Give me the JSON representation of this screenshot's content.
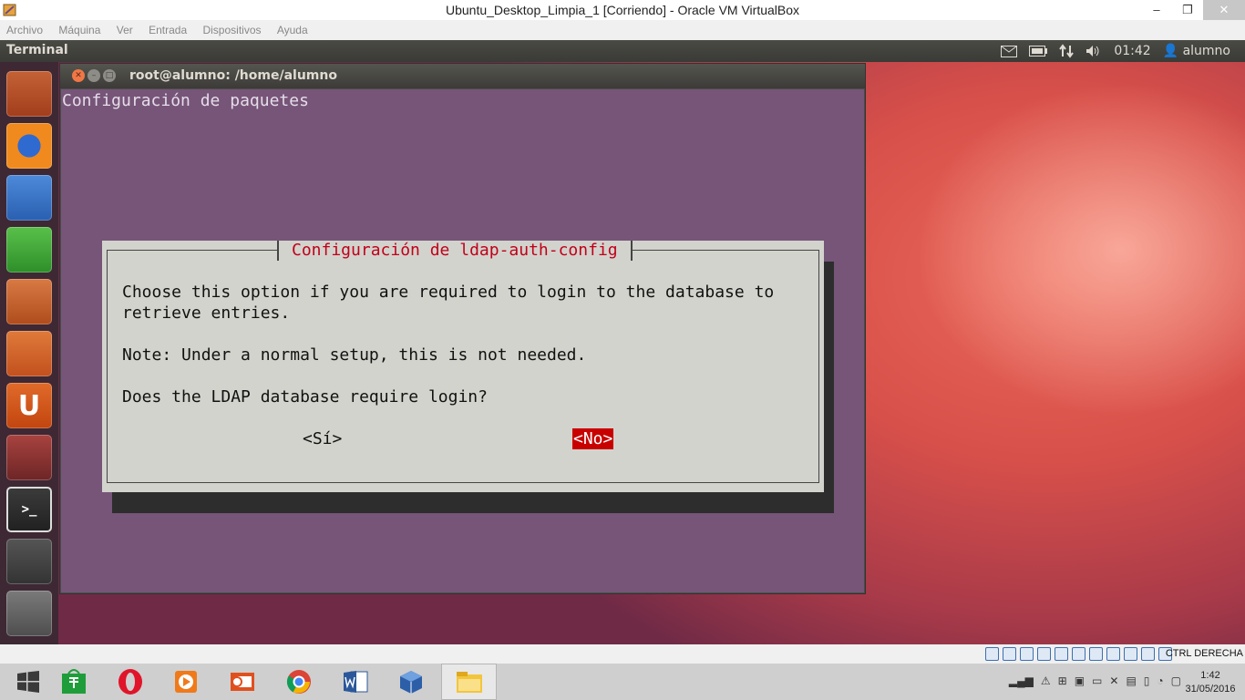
{
  "vbox": {
    "title": "Ubuntu_Desktop_Limpia_1 [Corriendo] - Oracle VM VirtualBox",
    "menu": [
      "Archivo",
      "Máquina",
      "Ver",
      "Entrada",
      "Dispositivos",
      "Ayuda"
    ],
    "window_buttons": {
      "minimize": "–",
      "restore": "❐",
      "close": "✕"
    },
    "host_key": "CTRL DERECHA"
  },
  "ubuntu_panel": {
    "title": "Terminal",
    "time": "01:42",
    "user": "alumno",
    "indicators": [
      "mail-icon",
      "battery-icon",
      "network-icon",
      "volume-icon"
    ]
  },
  "launcher": {
    "items": [
      {
        "name": "files",
        "glyph": "",
        "color": "#b8542a"
      },
      {
        "name": "firefox",
        "glyph": "",
        "color": "#2a58b8"
      },
      {
        "name": "writer",
        "glyph": "",
        "color": "#3a73c9"
      },
      {
        "name": "calc",
        "glyph": "",
        "color": "#3aa23a"
      },
      {
        "name": "impress",
        "glyph": "",
        "color": "#c05a2a"
      },
      {
        "name": "software-center",
        "glyph": "",
        "color": "#d0602a"
      },
      {
        "name": "ubuntu-one",
        "glyph": "U",
        "color": "#d65a1f"
      },
      {
        "name": "system-settings",
        "glyph": "",
        "color": "#8a3a3a"
      },
      {
        "name": "terminal",
        "glyph": ">_",
        "color": "#2c2c2c"
      },
      {
        "name": "workspaces",
        "glyph": "",
        "color": "#4a4a4a"
      },
      {
        "name": "trash",
        "glyph": "",
        "color": "#6a6a6a"
      }
    ]
  },
  "terminal": {
    "title": "root@alumno: /home/alumno",
    "header": "Configuración de paquetes"
  },
  "dialog": {
    "title": "Configuración de ldap-auth-config",
    "lines": [
      "Choose this option if you are required to login to the database to",
      "retrieve entries.",
      "Note: Under a normal setup, this is not needed.",
      "Does the LDAP database require login?"
    ],
    "yes_label": "<Sí>",
    "no_label": "<No>",
    "selected": "no"
  },
  "taskbar": {
    "apps": [
      "start",
      "store",
      "opera",
      "media-player",
      "presentation",
      "chrome",
      "word",
      "virtualbox",
      "file-explorer"
    ],
    "active": "file-explorer",
    "time": "1:42",
    "date": "31/05/2016"
  }
}
